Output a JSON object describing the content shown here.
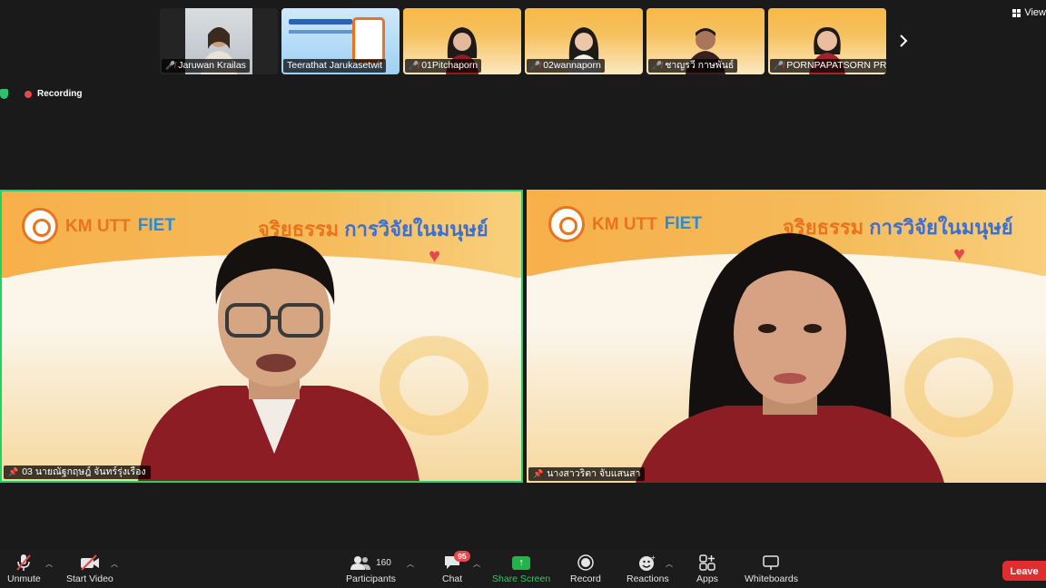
{
  "top_bar": {
    "view_label": "View"
  },
  "thumbnails": [
    {
      "name": "Jaruwan Krailas",
      "muted": true,
      "bg": "dark"
    },
    {
      "name": "Teerathat Jarukasetwit",
      "muted": false,
      "bg": "poster"
    },
    {
      "name": "01Pitchaporn",
      "muted": true,
      "bg": "slide"
    },
    {
      "name": "02wannaporn",
      "muted": true,
      "bg": "slide"
    },
    {
      "name": "ชาญรวี กาษพันธ์",
      "muted": true,
      "bg": "slide"
    },
    {
      "name": "PORNPAPATSORN PRIN...",
      "muted": true,
      "bg": "slide"
    }
  ],
  "recording": {
    "label": "Recording"
  },
  "tiles": [
    {
      "name": "03 นายณัฐกฤษฎ์ จันทร์รุ่งเรือง",
      "active_speaker": true,
      "slide_title_part1": "จริยธรรม",
      "slide_title_part2": "การวิจัยในมนุษย์",
      "logo1": "KM UTT",
      "logo2": "FIET"
    },
    {
      "name": "นางสาวริตา จับแสนสา",
      "active_speaker": false,
      "slide_title_part1": "จริยธรรม",
      "slide_title_part2": "การวิจัยในมนุษย์",
      "logo1": "KM UTT",
      "logo2": "FIET"
    }
  ],
  "toolbar": {
    "unmute": "Unmute",
    "start_video": "Start Video",
    "participants": "Participants",
    "participants_count": "160",
    "chat": "Chat",
    "chat_badge": "95",
    "share_screen": "Share Screen",
    "record": "Record",
    "reactions": "Reactions",
    "apps": "Apps",
    "whiteboards": "Whiteboards",
    "leave": "Leave"
  },
  "colors": {
    "active_border": "#23d160",
    "share_green": "#23b24b",
    "leave_red": "#e02e2e",
    "slide_orange": "#f7b04a"
  }
}
